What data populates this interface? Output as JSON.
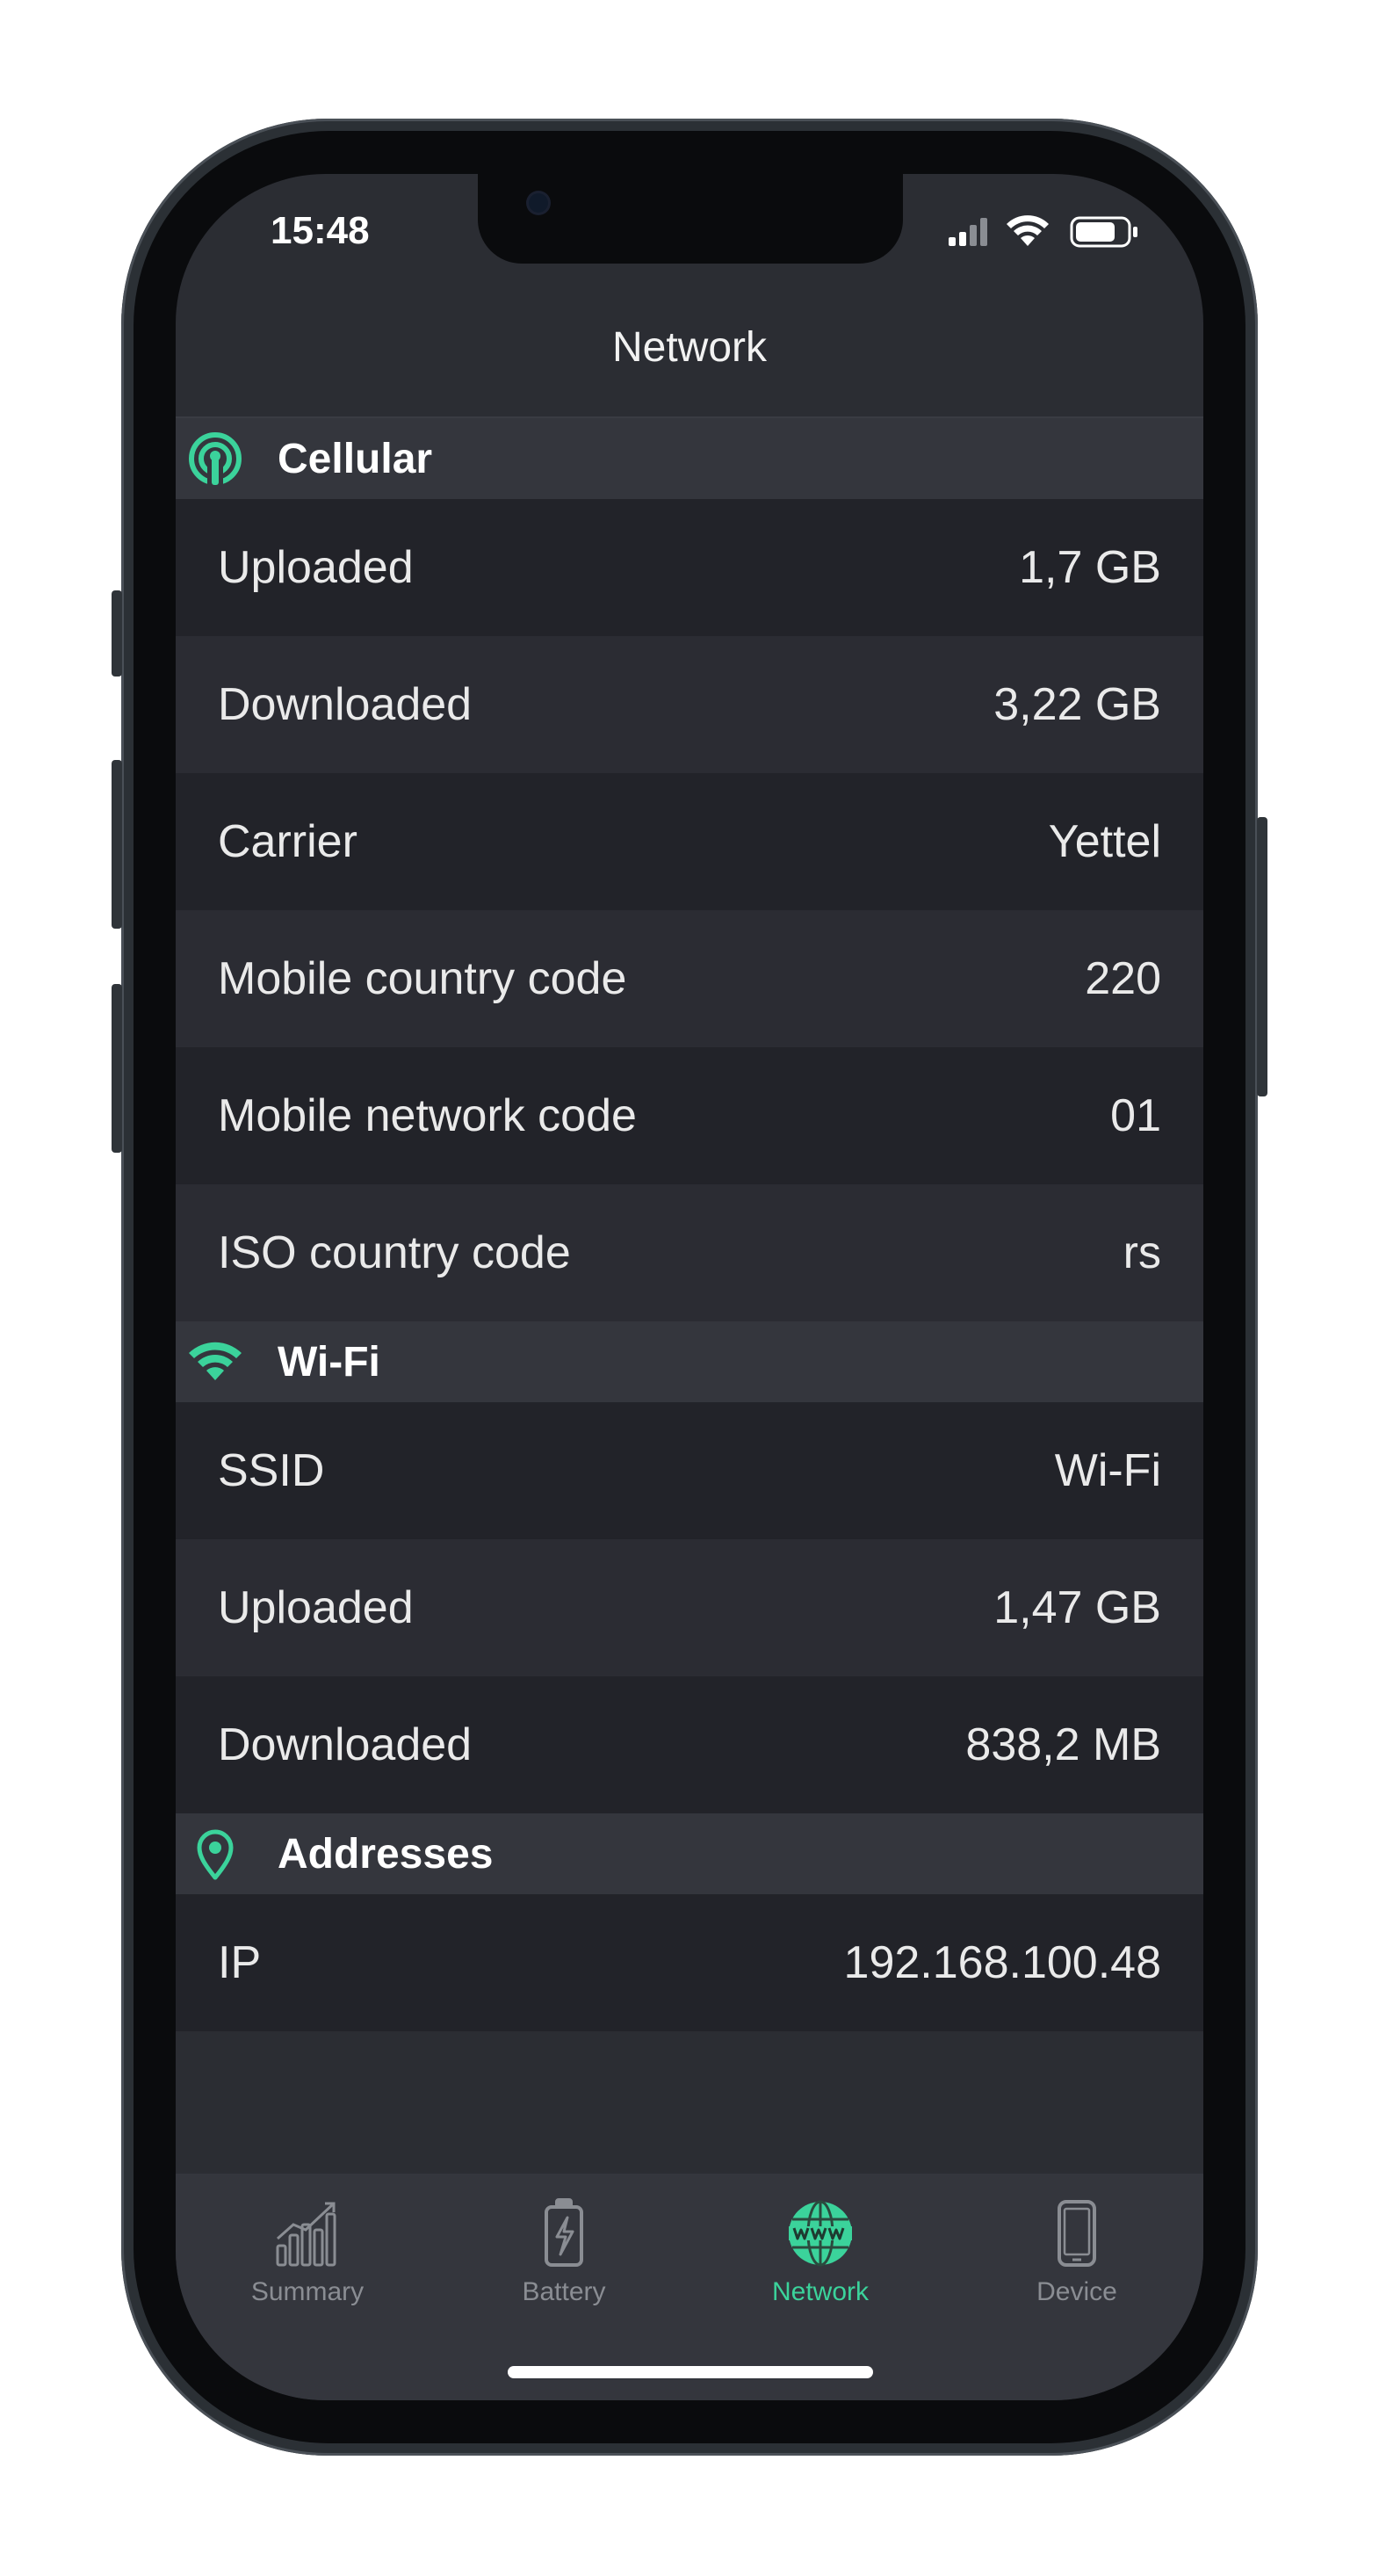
{
  "status_bar": {
    "time": "15:48"
  },
  "nav": {
    "title": "Network"
  },
  "sections": {
    "cellular": {
      "title": "Cellular",
      "icon": "cellular-antenna-icon",
      "rows": [
        {
          "label": "Uploaded",
          "value": "1,7 GB"
        },
        {
          "label": "Downloaded",
          "value": "3,22 GB"
        },
        {
          "label": "Carrier",
          "value": "Yettel"
        },
        {
          "label": "Mobile country code",
          "value": "220"
        },
        {
          "label": "Mobile network code",
          "value": "01"
        },
        {
          "label": "ISO country code",
          "value": "rs"
        }
      ]
    },
    "wifi": {
      "title": "Wi-Fi",
      "icon": "wifi-icon",
      "rows": [
        {
          "label": "SSID",
          "value": "Wi-Fi"
        },
        {
          "label": "Uploaded",
          "value": "1,47 GB"
        },
        {
          "label": "Downloaded",
          "value": "838,2 MB"
        }
      ]
    },
    "addresses": {
      "title": "Addresses",
      "icon": "location-pin-icon",
      "rows": [
        {
          "label": "IP",
          "value": "192.168.100.48"
        }
      ]
    }
  },
  "tabbar": {
    "tabs": [
      {
        "label": "Summary",
        "icon": "bar-chart-icon",
        "active": false
      },
      {
        "label": "Battery",
        "icon": "battery-icon",
        "active": false
      },
      {
        "label": "Network",
        "icon": "globe-www-icon",
        "active": true
      },
      {
        "label": "Device",
        "icon": "phone-device-icon",
        "active": false
      }
    ]
  },
  "colors": {
    "accent": "#3bd39b",
    "background": "#2b2d33",
    "section_header": "#34363d",
    "row_dark": "#222329",
    "row_light": "#2b2c33",
    "tab_inactive": "#8a8d93"
  }
}
